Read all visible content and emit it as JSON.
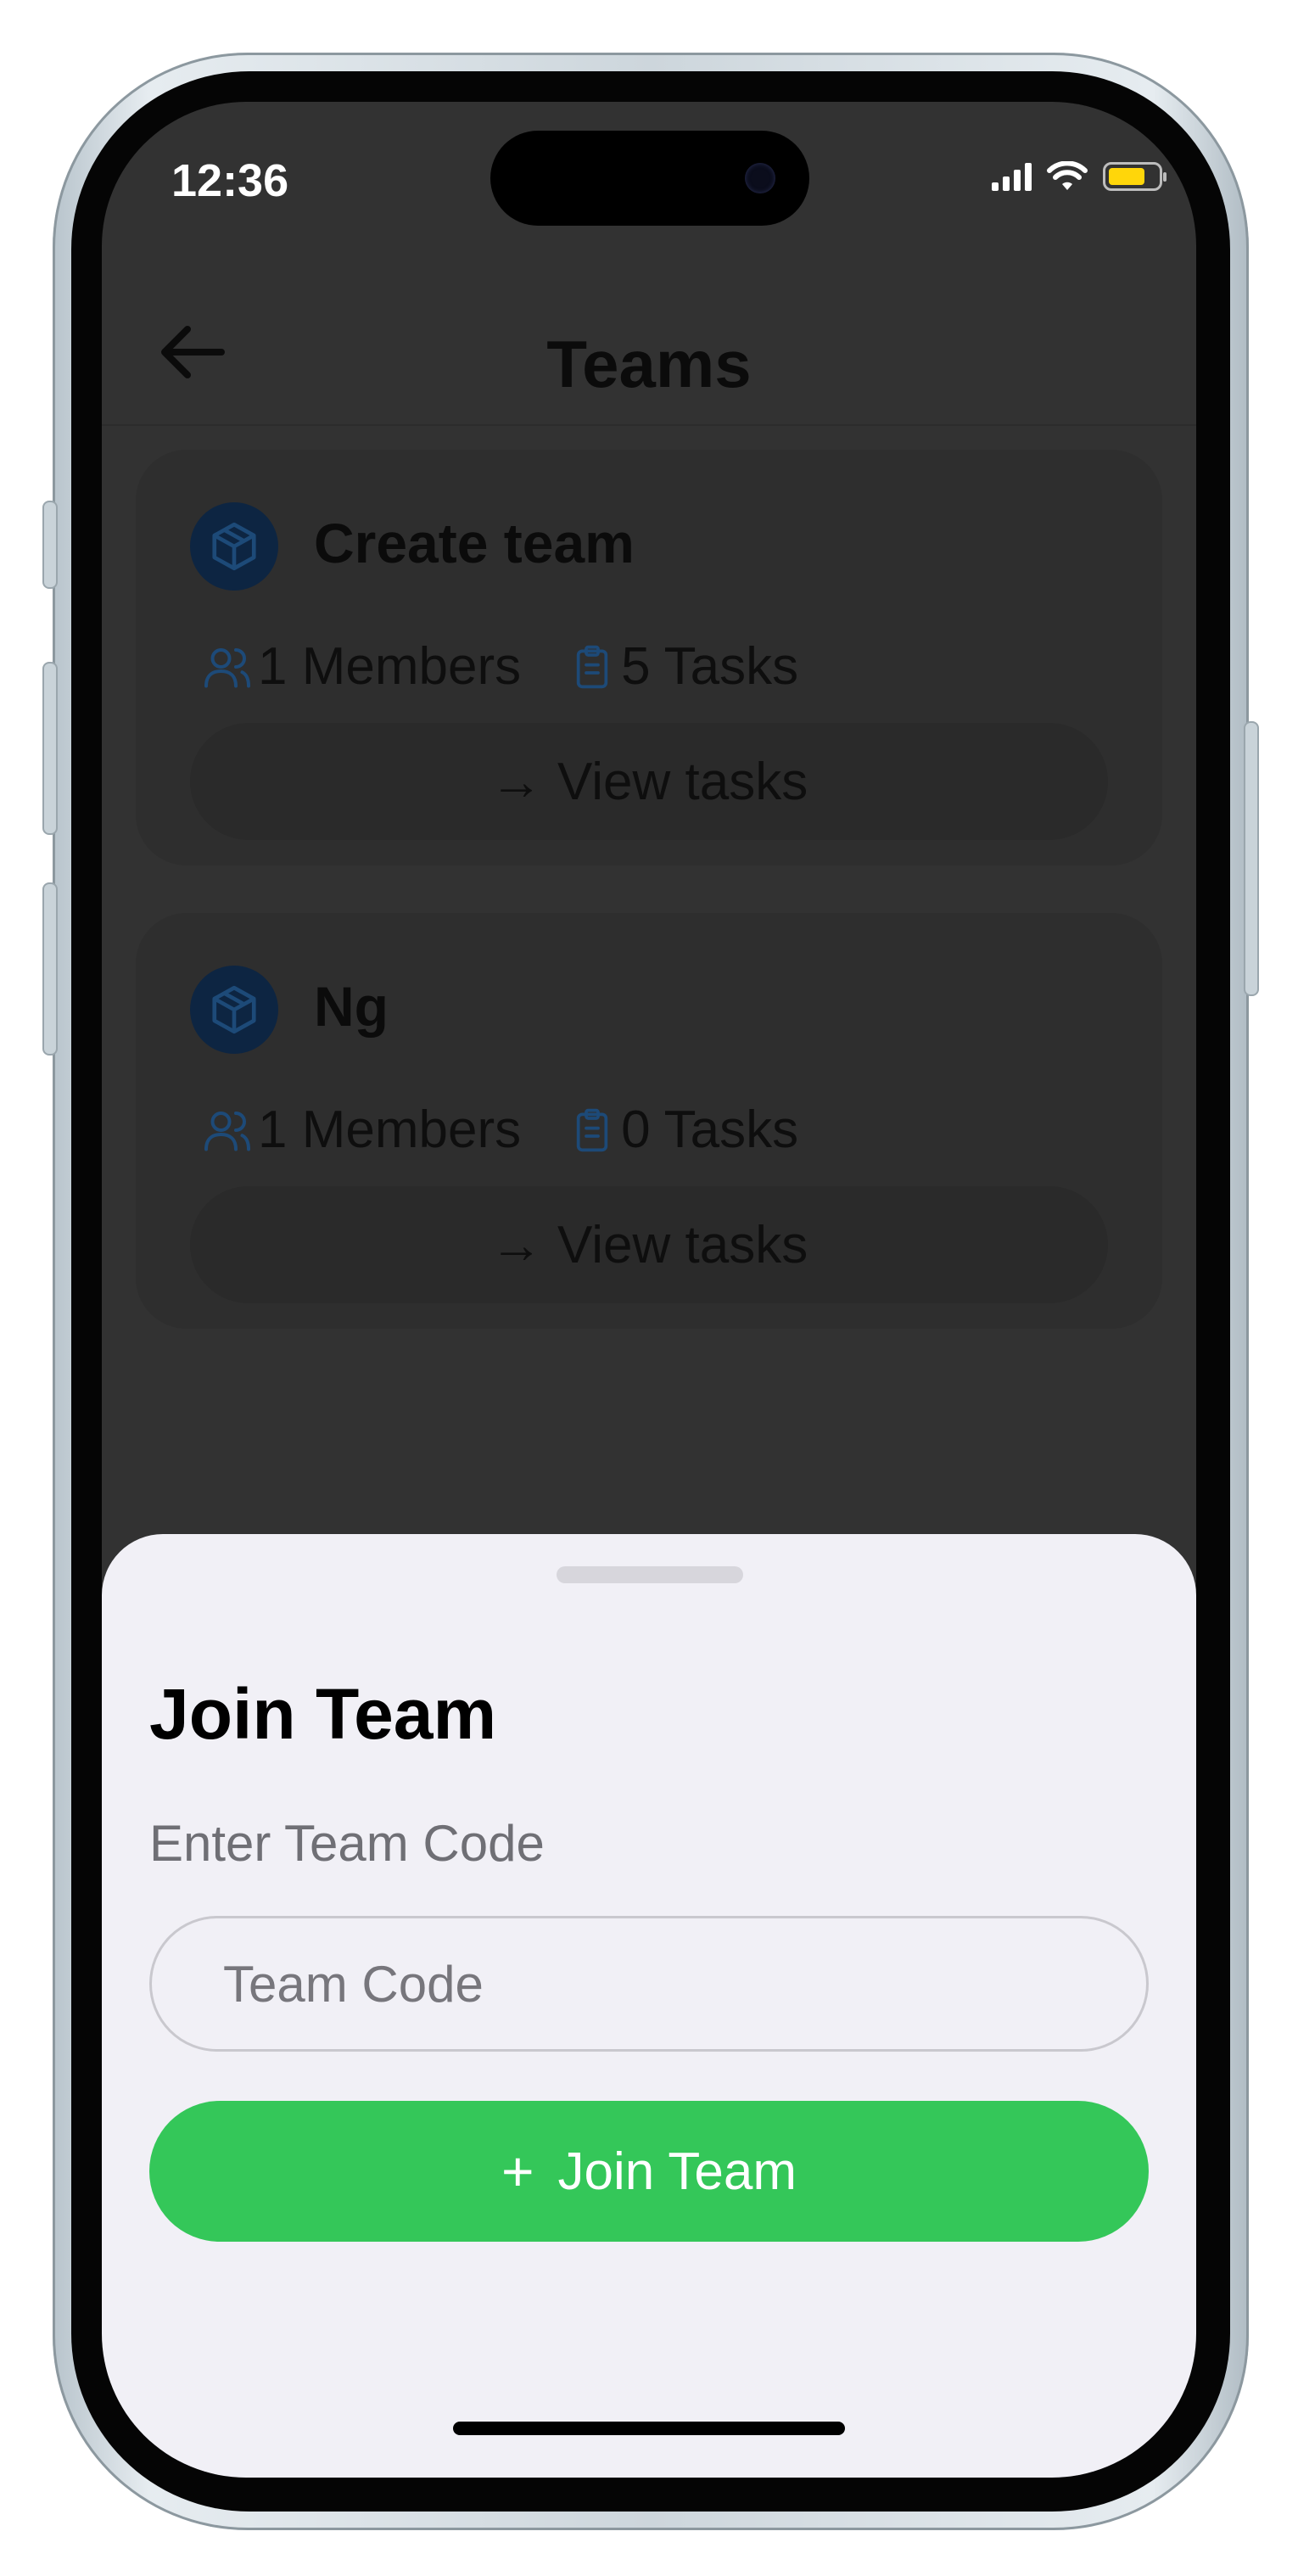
{
  "status_bar": {
    "time": "12:36"
  },
  "nav": {
    "title": "Teams"
  },
  "teams": [
    {
      "name": "Create team",
      "members": "1 Members",
      "tasks": "5 Tasks",
      "action": "→ View tasks"
    },
    {
      "name": "Ng",
      "members": "1 Members",
      "tasks": "0 Tasks",
      "action": "→ View tasks"
    }
  ],
  "sheet": {
    "title": "Join Team",
    "label": "Enter Team Code",
    "input_placeholder": "Team Code",
    "input_value": "",
    "join_button_icon": "+",
    "join_button_label": "Join Team"
  },
  "icons": {
    "back": "arrow-left-icon",
    "team": "box-icon",
    "members": "users-icon",
    "tasks": "clipboard-icon",
    "join": "plus-icon"
  },
  "colors": {
    "accent_green": "#34c759",
    "team_icon_bg": "#0d2542",
    "team_icon_fg": "#1d4a78",
    "sheet_bg": "#f1f0f6",
    "battery": "#ffd60a"
  }
}
